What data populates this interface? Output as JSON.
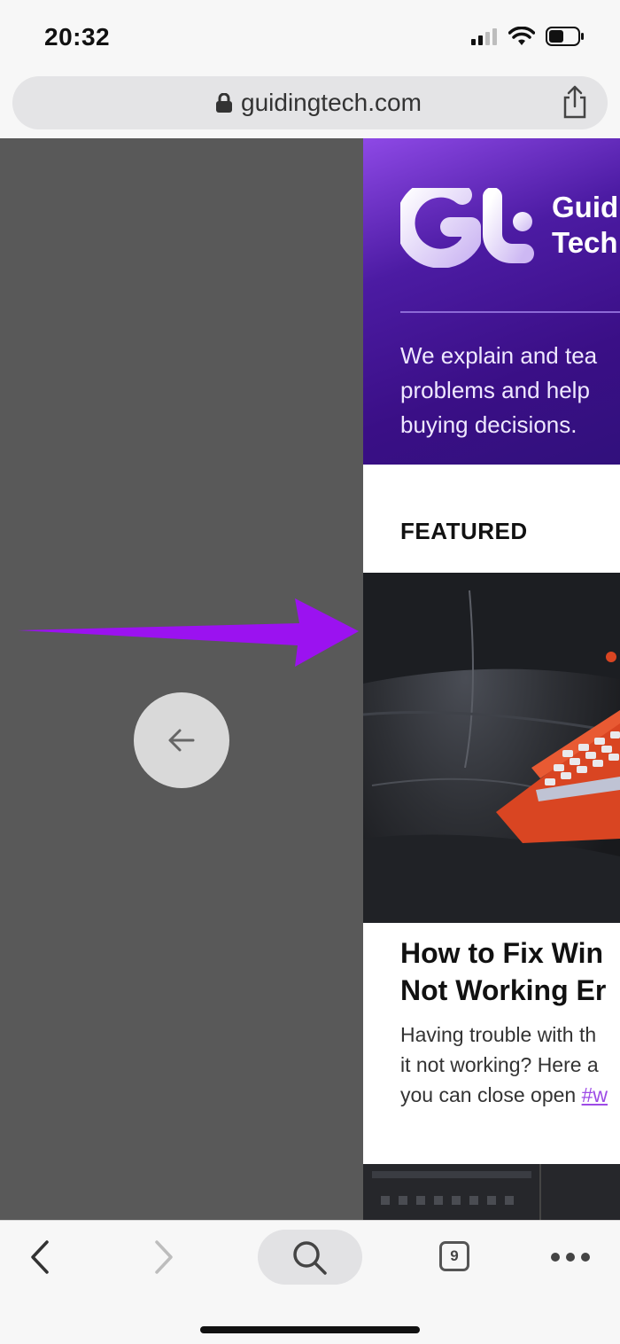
{
  "status_bar": {
    "time": "20:32"
  },
  "browser": {
    "url": "guidingtech.com"
  },
  "page": {
    "brand_lines": [
      "Guid",
      "Tech"
    ],
    "tagline_lines": [
      "We explain and tea",
      "problems and help ",
      "buying decisions."
    ],
    "section_heading": "FEATURED",
    "article": {
      "title_lines": [
        "How to Fix Win",
        "Not Working Er"
      ],
      "excerpt_lines": [
        "Having trouble with th",
        "it not working? Here a"
      ],
      "excerpt_last_prefix": "you can close open ",
      "hashtag": "#w"
    }
  },
  "toolbar": {
    "tab_count": "9"
  },
  "colors": {
    "annotation_arrow": "#9b12f0",
    "hero_purple": "#3a0f86"
  }
}
